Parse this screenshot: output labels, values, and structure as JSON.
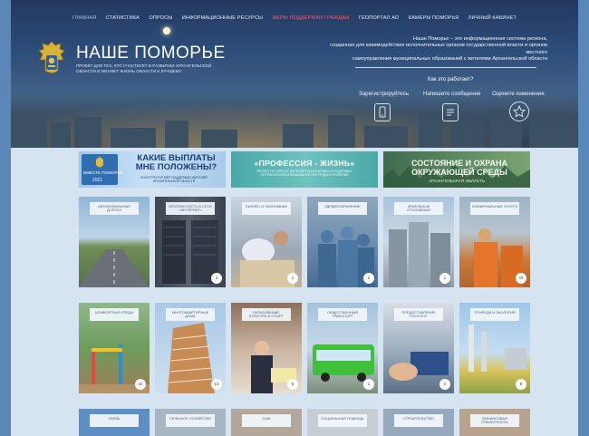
{
  "nav": {
    "items": [
      "ГЛАВНАЯ",
      "СТАТИСТИКА",
      "ОПРОСЫ",
      "ИНФОРМАЦИОННЫЕ РЕСУРСЫ",
      "МЕРЫ ПОДДЕРЖКИ ГРАЖДАН",
      "ГЕОПОРТАЛ АО",
      "КАМЕРЫ ПОМОРЬЯ",
      "ЛИЧНЫЙ КАБИНЕТ"
    ]
  },
  "brand": {
    "name": "НАШЕ ПОМОРЬЕ",
    "tagline": "ПРОЕКТ ДЛЯ ТЕХ, КТО УЧАСТВУЕТ В РАЗВИТИИ АРХАНГЕЛЬСКОЙ ОБЛАСТИ И МЕНЯЕТ ЖИЗНЬ ОБЛАСТИ К ЛУЧШЕМУ"
  },
  "intro": {
    "line1": "Наше Поморье – это информационная система региона,",
    "line2": "созданная для взаимодействия исполнительных органов государственной власти и органов местного",
    "line3": "самоуправления муниципальных образований с жителями Архангельской области"
  },
  "how": {
    "label": "Как это работает?"
  },
  "actions": {
    "register": "Зарегистрируйтесь",
    "message": "Напишите сообщение",
    "rate": "Оцените изменения"
  },
  "banners": {
    "b1": {
      "logo": "ВМЕСТЕ ПОМОРЬЕ",
      "year": "2021",
      "title": "КАКИЕ ВЫПЛАТЫ МНЕ ПОЛОЖЕНЫ?",
      "sub": "КОНСТРУКТОР МЕР ПОДДЕРЖКИ ЖИТЕЛЕЙ АРХАНГЕЛЬСКОЙ ОБЛАСТИ"
    },
    "b2": {
      "title": "«ПРОФЕССИЯ - ЖИЗНЬ»",
      "sub": "ПРОЕКТ ПО ОПРОСУ ЖИТЕЛЕЙ ПО ИЗУЧЕНИЮ ИХ КАДРОВЫХ ПОТРЕБНОСТЕЙ И ВОЗМОЖНОСТЕЙ ТРУДОУСТРОЙСТВА"
    },
    "b3": {
      "title": "СОСТОЯНИЕ И ОХРАНА ОКРУЖАЮЩЕЙ СРЕДЫ",
      "sub": "АРХАНГЕЛЬСКАЯ ОБЛАСТЬ"
    }
  },
  "tiles_row1": [
    {
      "label": "АВТОМОБИЛЬНЫЕ ДОРОГИ",
      "count": ""
    },
    {
      "label": "БЕЗОПАСНОСТЬ В СЕТИ «ИНТЕРНЕТ»",
      "count": "3"
    },
    {
      "label": "БИЗНЕС И ЭКОНОМИКА",
      "count": "1"
    },
    {
      "label": "ЗДРАВООХРАНЕНИЕ",
      "count": "2"
    },
    {
      "label": "ЗЕМЕЛЬНЫЕ ОТНОШЕНИЯ",
      "count": "1"
    },
    {
      "label": "КОММУНАЛЬНЫЕ УСЛУГИ",
      "count": "33"
    }
  ],
  "tiles_row2": [
    {
      "label": "КОМФОРТНАЯ СРЕДА",
      "count": "22"
    },
    {
      "label": "МНОГОКВАРТИРНЫЕ ДОМА",
      "count": "13"
    },
    {
      "label": "ОБРАЗОВАНИЕ, КУЛЬТУРА И СПОРТ",
      "count": "5"
    },
    {
      "label": "ОБЩЕСТВЕННЫЙ ТРАНСПОРТ",
      "count": "1"
    },
    {
      "label": "ПРЕДОСТАВЛЕНИЕ ГОСУСЛУГ",
      "count": "2"
    },
    {
      "label": "ПРИРОДА И ЭКОЛОГИЯ",
      "count": "9"
    }
  ],
  "tiles_row3": [
    {
      "label": "СВЯЗЬ"
    },
    {
      "label": "СЕЛЬСКОЕ ХОЗЯЙСТВО"
    },
    {
      "label": "СМИ"
    },
    {
      "label": "СОЦИАЛЬНАЯ ПОМОЩЬ"
    },
    {
      "label": "СТРОИТЕЛЬСТВО"
    },
    {
      "label": "ФИНАНСОВАЯ ГРАМОТНОСТЬ"
    }
  ],
  "colors": {
    "header_top": "#23385f",
    "content_bg": "#d6e3f1",
    "highlight": "#ff5a6a"
  }
}
